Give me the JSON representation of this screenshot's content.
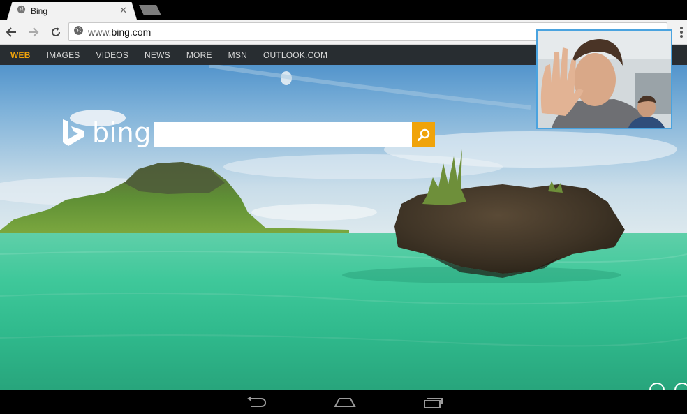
{
  "browser": {
    "tab_title": "Bing",
    "url_prefix": "www.",
    "url_domain": "bing.com"
  },
  "bing": {
    "nav": [
      "WEB",
      "IMAGES",
      "VIDEOS",
      "NEWS",
      "MORE",
      "MSN",
      "OUTLOOK.COM"
    ],
    "active_nav": "WEB",
    "logo_text": "bing",
    "search_value": "",
    "accent_color": "#f0a30a"
  },
  "video_call": {
    "border_color": "#4aa3df"
  },
  "system_bar": {
    "buttons": [
      "back-icon",
      "home-icon",
      "recent-apps-icon"
    ]
  }
}
